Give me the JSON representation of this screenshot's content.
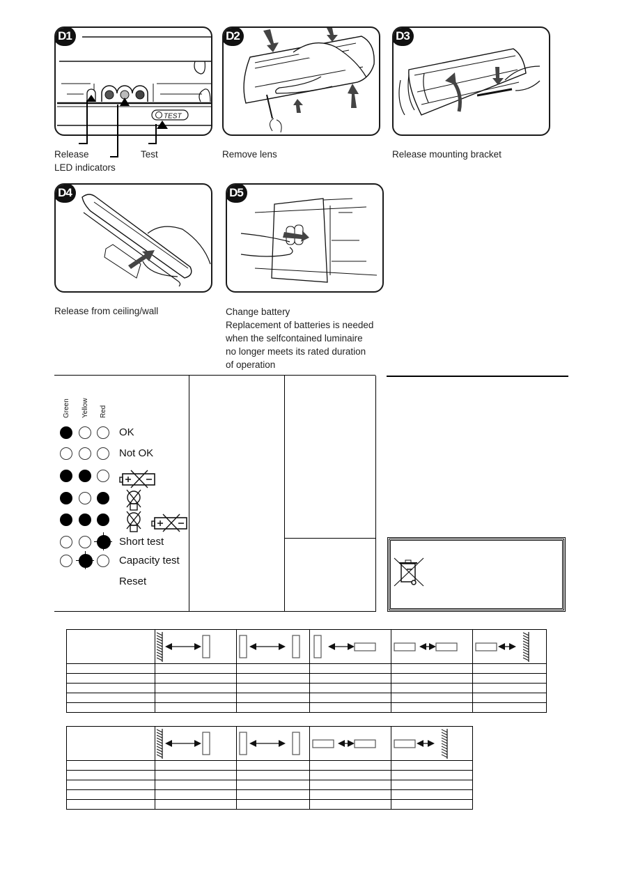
{
  "steps": [
    {
      "id": "D1",
      "badge": "D1",
      "captions": [
        "Release",
        "LED indicators",
        "Test"
      ],
      "inset_label": "TEST"
    },
    {
      "id": "D2",
      "badge": "D2",
      "captions": [
        "Remove lens"
      ]
    },
    {
      "id": "D3",
      "badge": "D3",
      "captions": [
        "Release mounting bracket"
      ]
    },
    {
      "id": "D4",
      "badge": "D4",
      "captions": [
        "Release from ceiling/wall"
      ]
    },
    {
      "id": "D5",
      "badge": "D5",
      "captions": [
        "Change battery",
        "Replacement of batteries is needed",
        "when the selfcontained luminaire",
        "no longer meets its rated duration",
        "of operation"
      ]
    }
  ],
  "led_table": {
    "columns": [
      "Green",
      "Yellow",
      "Red"
    ],
    "rows": [
      {
        "states": [
          "on",
          "off",
          "off"
        ],
        "label": "OK",
        "icon": null
      },
      {
        "states": [
          "off",
          "off",
          "off"
        ],
        "label": "Not OK",
        "icon": null
      },
      {
        "states": [
          "on",
          "on",
          "off"
        ],
        "label": "",
        "icon": "battery-fault-icon"
      },
      {
        "states": [
          "on",
          "off",
          "on"
        ],
        "label": "",
        "icon": "lamp-fault-icon"
      },
      {
        "states": [
          "on",
          "on",
          "on"
        ],
        "label": "",
        "icon": "lamp-and-battery-fault-icon"
      },
      {
        "states": [
          "off",
          "off",
          "blink"
        ],
        "label": "Short test",
        "icon": null
      },
      {
        "states": [
          "off",
          "blink",
          "off"
        ],
        "label": "Capacity test",
        "icon": null
      },
      {
        "states": [
          null,
          null,
          null
        ],
        "label": "Reset",
        "icon": null
      }
    ]
  },
  "weee": {
    "icon": "crossed-out-wheelie-bin-icon"
  },
  "spacing_tables": [
    {
      "columns": [
        "wall-to-luminaire",
        "luminaire-to-luminaire",
        "luminaire-to-corridor",
        "corridor-to-corridor",
        "corridor-to-wall"
      ],
      "rows": 5
    },
    {
      "columns": [
        "wall-to-luminaire",
        "luminaire-to-luminaire",
        "corridor-to-corridor",
        "corridor-to-wall"
      ],
      "rows": 5
    }
  ]
}
